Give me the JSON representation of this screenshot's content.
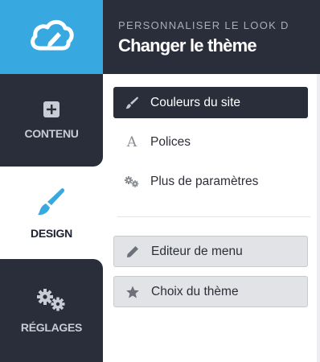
{
  "header": {
    "kicker": "PERSONNALISER LE LOOK D",
    "title": "Changer le thème"
  },
  "rail": {
    "logo_icon": "cloud-pen-icon",
    "items": [
      {
        "label": "CONTENU",
        "icon": "plus-square-icon"
      },
      {
        "label": "DESIGN",
        "icon": "paintbrush-icon"
      },
      {
        "label": "RÉGLAGES",
        "icon": "gears-icon"
      }
    ]
  },
  "menu": {
    "items": [
      {
        "label": "Couleurs du site",
        "icon": "paintbrush-icon",
        "active": true
      },
      {
        "label": "Polices",
        "icon": "font-a-icon"
      },
      {
        "label": "Plus de paramètres",
        "icon": "gears-icon"
      }
    ],
    "tools": [
      {
        "label": "Editeur de menu",
        "icon": "pencil-icon"
      },
      {
        "label": "Choix du thème",
        "icon": "star-icon"
      }
    ]
  },
  "colors": {
    "dark": "#2a2e3b",
    "accent": "#38a8e0",
    "active_item": "#2a2e3b",
    "boxed_item": "#e2e3e7"
  }
}
